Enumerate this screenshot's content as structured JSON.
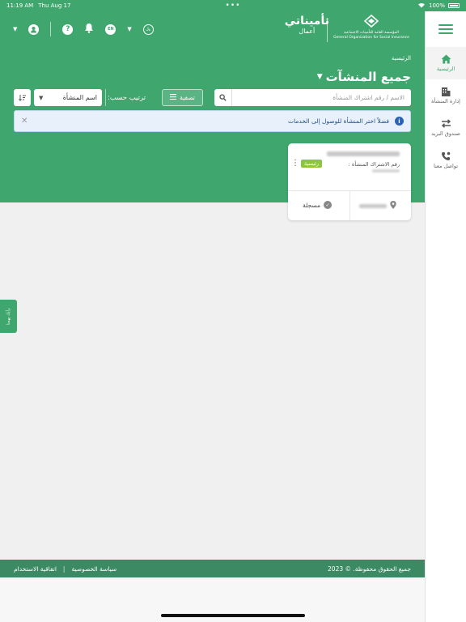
{
  "status_bar": {
    "time": "11:19 AM",
    "date": "Thu Aug 17",
    "battery": "100%"
  },
  "header": {
    "brand_title": "تأميناتي",
    "brand_subtitle": "أعمال",
    "org_name_ar": "المؤسسة العامة للتأمينات الاجتماعية",
    "org_name_en": "General Organization for Social Insurance",
    "lang_badge": "EN"
  },
  "sidebar": {
    "items": [
      {
        "label": "الرئيسية",
        "icon": "home-icon",
        "active": true
      },
      {
        "label": "إدارة المنشأة",
        "icon": "building-icon",
        "active": false
      },
      {
        "label": "صندوق البريد",
        "icon": "exchange-icon",
        "active": false
      },
      {
        "label": "تواصل معنا",
        "icon": "phone-icon",
        "active": false
      }
    ]
  },
  "main": {
    "breadcrumb": "الرئيسية",
    "title": "جميع المنشآت",
    "search_placeholder": "الاسم / رقم اشتراك المنشأة",
    "filter_label": "تصفية",
    "sort_label": "ترتيب حسب:",
    "sort_value": "اسم المنشأة",
    "alert_text": "فضلاً اختر المنشأة للوصول إلى الخدمات",
    "card": {
      "subscription_label": "رقم الاشتراك المنشأة :",
      "badge": "رئيسية",
      "status": "مسجلة"
    }
  },
  "side_tab": {
    "label": "رأيك يهمنا"
  },
  "footer": {
    "copyright": "جميع الحقوق محفوظة. © 2023",
    "privacy": "سياسة الخصوصية",
    "divider": "|",
    "terms": "اتفاقية الاستخدام"
  },
  "colors": {
    "primary": "#3fa76e",
    "footer": "#3b8a63",
    "badge": "#8cc63f",
    "info": "#2a63b3"
  }
}
